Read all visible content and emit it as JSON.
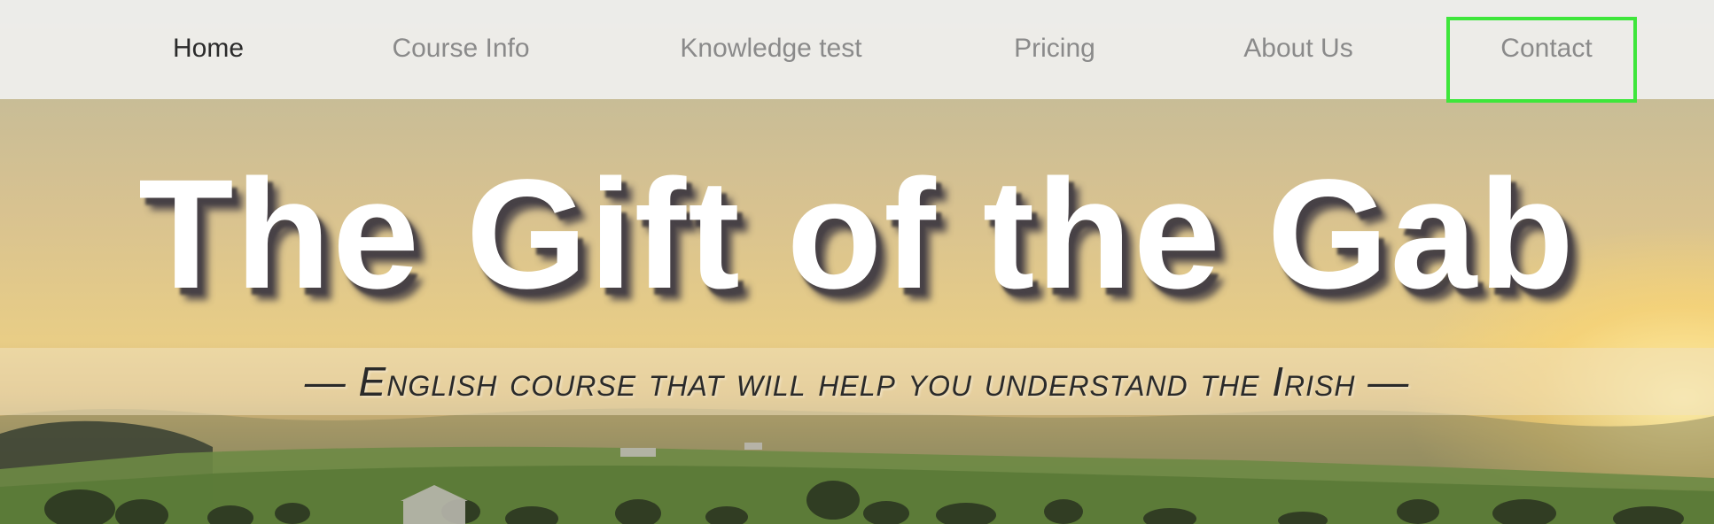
{
  "nav": {
    "items": [
      {
        "label": "Home",
        "active": true
      },
      {
        "label": "Course Info",
        "active": false
      },
      {
        "label": "Knowledge test",
        "active": false
      },
      {
        "label": "Pricing",
        "active": false
      },
      {
        "label": "About Us",
        "active": false
      },
      {
        "label": "Contact",
        "active": false
      }
    ]
  },
  "hero": {
    "title": "The Gift of the Gab",
    "subtitle": "— English course that will help you understand the Irish —"
  },
  "colors": {
    "nav_active": "#2b2b2b",
    "nav_inactive": "#8a8a8a",
    "highlight_box": "#3ee63b",
    "title_text": "#ffffff"
  }
}
